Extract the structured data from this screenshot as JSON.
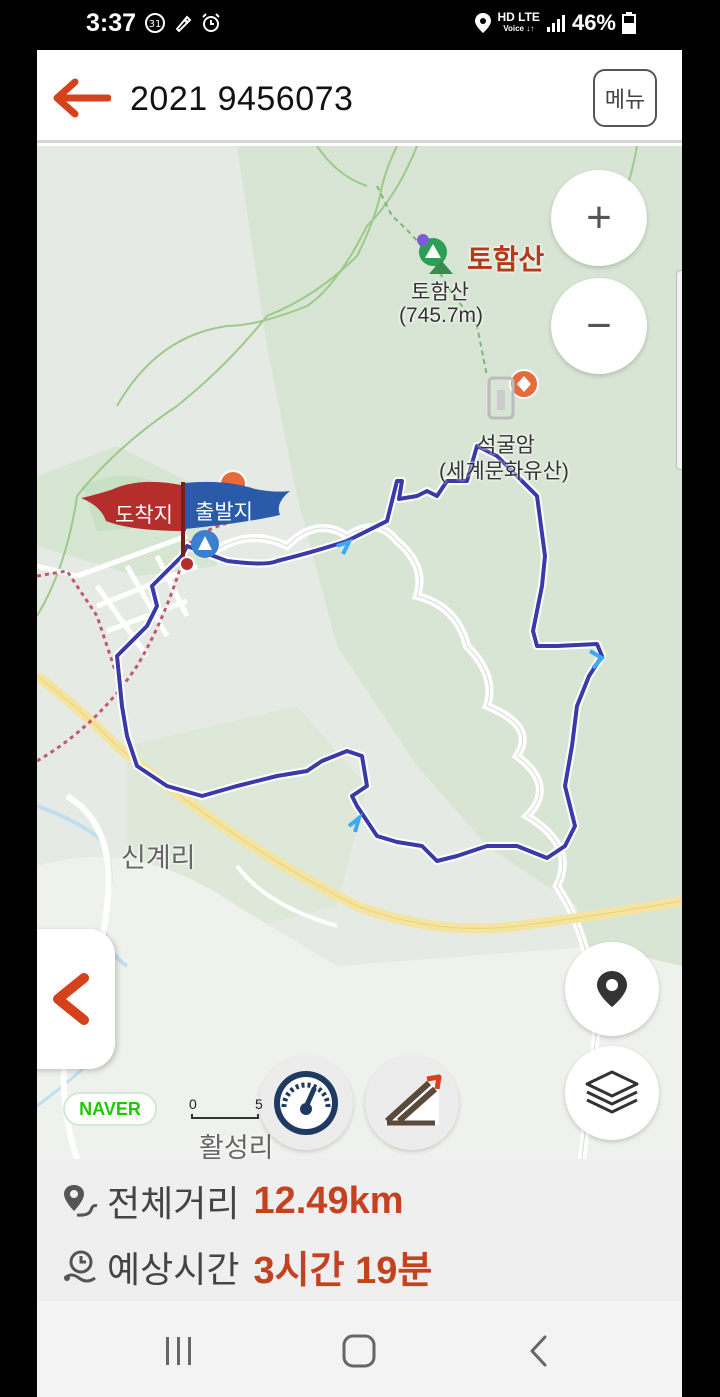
{
  "status_bar": {
    "time": "3:37",
    "left_icons": [
      "calendar-31-icon",
      "rocket-icon",
      "alarm-icon"
    ],
    "network_top": "HD LTE",
    "network_bottom": "Voice ↓↑",
    "battery": "46%"
  },
  "app_bar": {
    "title": "2021 9456073",
    "menu_label": "메뉴"
  },
  "map": {
    "mountain_title": "토함산",
    "peak_name": "토함산",
    "peak_elevation": "(745.7m)",
    "temple_name": "석굴암",
    "temple_sub": "(세계문화유산)",
    "village_1": "신계리",
    "village_2": "활성리",
    "finish_flag": "도착지",
    "start_flag": "출발지",
    "attribution": "NAVER",
    "scale_start": "0",
    "scale_end": "5",
    "route_color": "#3a3aa8",
    "finish_flag_color": "#b42e2b",
    "start_flag_color": "#2a5ba8"
  },
  "controls": {
    "zoom_in": "+",
    "zoom_out": "−"
  },
  "info": {
    "distance_label": "전체거리",
    "distance_value": "12.49km",
    "time_label": "예상시간",
    "time_value": "3시간 19분",
    "accent_color": "#c4421f"
  },
  "nav": {
    "recents": "recents-icon",
    "home": "home-icon",
    "back": "back-icon"
  }
}
